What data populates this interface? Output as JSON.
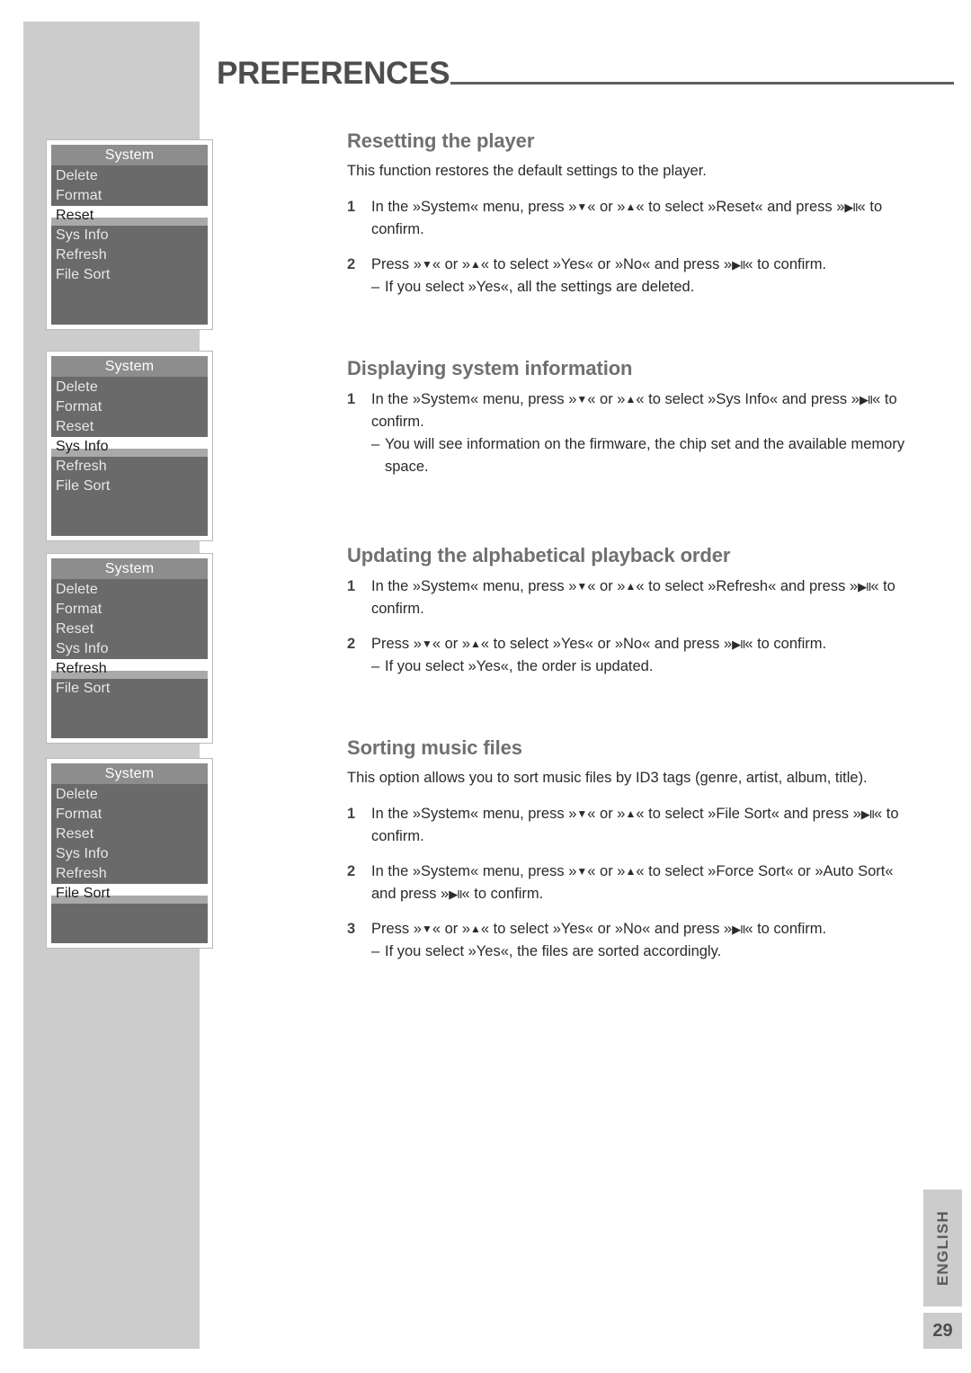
{
  "header": {
    "title": "PREFERENCES"
  },
  "sidebar": {
    "menu_panels": [
      {
        "name": "reset-menu",
        "header": "System",
        "items": [
          "Delete",
          "Format",
          "Reset",
          "Sys Info",
          "Refresh",
          "File Sort"
        ],
        "selected": "Reset",
        "blank_rows": 2
      },
      {
        "name": "sys-info-menu",
        "header": "System",
        "items": [
          "Delete",
          "Format",
          "Reset",
          "Sys Info",
          "Refresh",
          "File Sort"
        ],
        "selected": "Sys Info",
        "blank_rows": 2
      },
      {
        "name": "refresh-menu",
        "header": "System",
        "items": [
          "Delete",
          "Format",
          "Reset",
          "Sys Info",
          "Refresh",
          "File Sort"
        ],
        "selected": "Refresh",
        "blank_rows": 2
      },
      {
        "name": "file-sort-menu",
        "header": "System",
        "items": [
          "Delete",
          "Format",
          "Reset",
          "Sys Info",
          "Refresh",
          "File Sort"
        ],
        "selected": "File Sort",
        "blank_rows": 2
      }
    ]
  },
  "content": {
    "sections": [
      {
        "title": "Resetting the player",
        "intro": "This function restores the default settings to the player.",
        "steps": [
          {
            "num": "1",
            "text_parts": [
              {
                "t": "In the »System« menu, press »"
              },
              {
                "g": "down-arrow"
              },
              {
                "t": "« or »"
              },
              {
                "g": "up-arrow"
              },
              {
                "t": "« to select »Reset« and press »"
              },
              {
                "g": "play-pause"
              },
              {
                "t": "« to confirm."
              }
            ]
          },
          {
            "num": "2",
            "text_parts": [
              {
                "t": "Press »"
              },
              {
                "g": "down-arrow"
              },
              {
                "t": "« or »"
              },
              {
                "g": "up-arrow"
              },
              {
                "t": "« to select »Yes« or »No« and press »"
              },
              {
                "g": "play-pause"
              },
              {
                "t": "« to confirm."
              }
            ],
            "sub": "If you select »Yes«, all the settings are deleted."
          }
        ]
      },
      {
        "title": "Displaying system information",
        "intro": null,
        "steps": [
          {
            "num": "1",
            "text_parts": [
              {
                "t": "In the »System« menu, press »"
              },
              {
                "g": "down-arrow"
              },
              {
                "t": "« or »"
              },
              {
                "g": "up-arrow"
              },
              {
                "t": "« to select »Sys Info« and press »"
              },
              {
                "g": "play-pause"
              },
              {
                "t": "« to confirm."
              }
            ],
            "sub": "You will see information on the firmware, the chip set and the available memory space."
          }
        ]
      },
      {
        "title": "Updating the alphabetical playback order",
        "intro": null,
        "steps": [
          {
            "num": "1",
            "text_parts": [
              {
                "t": "In the »System« menu, press »"
              },
              {
                "g": "down-arrow"
              },
              {
                "t": "« or »"
              },
              {
                "g": "up-arrow"
              },
              {
                "t": "« to select »Refresh« and press »"
              },
              {
                "g": "play-pause"
              },
              {
                "t": "« to confirm."
              }
            ]
          },
          {
            "num": "2",
            "text_parts": [
              {
                "t": "Press »"
              },
              {
                "g": "down-arrow"
              },
              {
                "t": "« or »"
              },
              {
                "g": "up-arrow"
              },
              {
                "t": "« to select »Yes« or »No« and press »"
              },
              {
                "g": "play-pause"
              },
              {
                "t": "« to confirm."
              }
            ],
            "sub": "If you select »Yes«, the order is updated."
          }
        ]
      },
      {
        "title": "Sorting music files",
        "intro": "This option allows you to sort music files by ID3 tags (genre, artist, album, title).",
        "steps": [
          {
            "num": "1",
            "text_parts": [
              {
                "t": "In the »System« menu, press »"
              },
              {
                "g": "down-arrow"
              },
              {
                "t": "« or »"
              },
              {
                "g": "up-arrow"
              },
              {
                "t": "« to select »File Sort« and press »"
              },
              {
                "g": "play-pause"
              },
              {
                "t": "« to confirm."
              }
            ]
          },
          {
            "num": "2",
            "text_parts": [
              {
                "t": "In the »System« menu, press »"
              },
              {
                "g": "down-arrow"
              },
              {
                "t": "« or »"
              },
              {
                "g": "up-arrow"
              },
              {
                "t": "« to select »Force Sort« or »Auto Sort« and press »"
              },
              {
                "g": "play-pause"
              },
              {
                "t": "« to confirm."
              }
            ]
          },
          {
            "num": "3",
            "text_parts": [
              {
                "t": "Press »"
              },
              {
                "g": "down-arrow"
              },
              {
                "t": "« or »"
              },
              {
                "g": "up-arrow"
              },
              {
                "t": "« to select »Yes« or »No« and press »"
              },
              {
                "g": "play-pause"
              },
              {
                "t": "« to confirm."
              }
            ],
            "sub": "If you select »Yes«, the files are sorted accordingly."
          }
        ]
      }
    ],
    "substep_dash": "–"
  },
  "footer": {
    "language": "ENGLISH",
    "page_number": "29"
  },
  "glyphs": {
    "down-arrow": "▼",
    "up-arrow": "▲",
    "play-pause": "▶II"
  },
  "colors": {
    "band": "#cccccc",
    "title": "#4d4d4d",
    "heading": "#707070",
    "menu_header_bg": "#8d8d8d",
    "menu_body_bg": "#6a6a6a",
    "menu_selected_bg": "#ffffff"
  }
}
